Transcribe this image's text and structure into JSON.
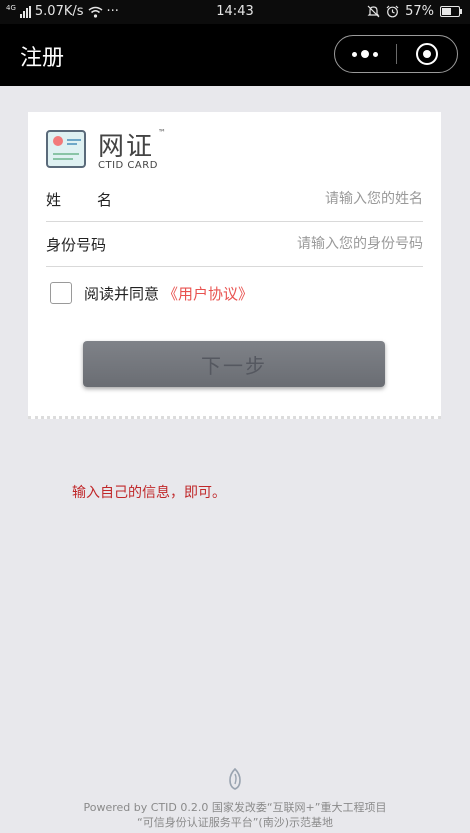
{
  "status_bar": {
    "network": "4G",
    "speed": "5.07K/s",
    "more": "···",
    "time": "14:43",
    "battery": "57%",
    "battery_level": 0.57
  },
  "nav": {
    "title": "注册"
  },
  "card": {
    "logo_cn": "网证",
    "logo_tm": "™",
    "logo_en": "CTID CARD",
    "name_label": "姓名",
    "name_placeholder": "请输入您的姓名",
    "id_label": "身份号码",
    "id_placeholder": "请输入您的身份号码",
    "agree_text": "阅读并同意",
    "agree_link": "《用户协议》",
    "next_button": "下一步"
  },
  "annotation": "输入自己的信息，即可。",
  "footer": {
    "line1": "Powered by CTID 0.2.0 国家发改委“互联网+”重大工程项目",
    "line2": "“可信身份认证服务平台”(南沙)示范基地"
  },
  "colors": {
    "link": "#e8524f",
    "note": "#c0282a",
    "button": "#75787e"
  }
}
